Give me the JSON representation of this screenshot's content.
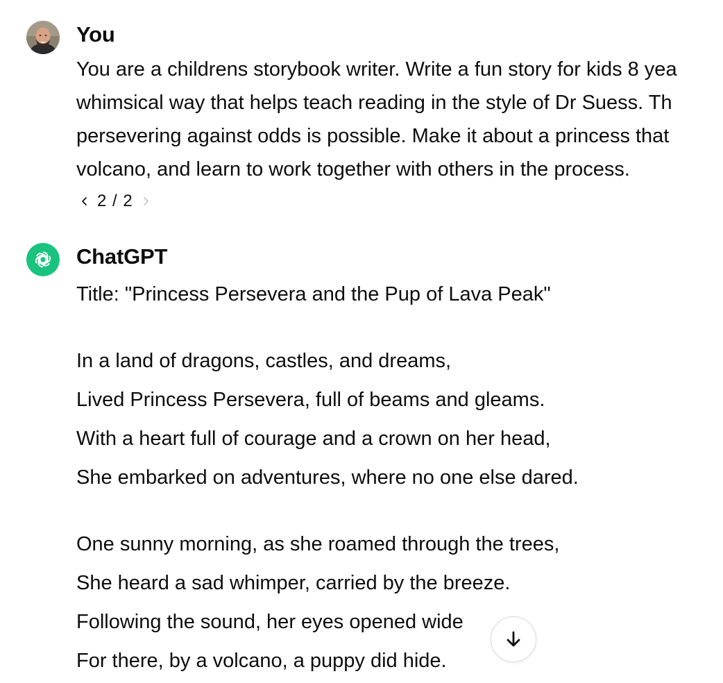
{
  "user": {
    "name": "You",
    "message_lines": [
      "You are a childrens storybook writer. Write a fun story for kids 8 yea",
      "whimsical way that helps teach reading in the style of Dr Suess. Th",
      "persevering against odds is possible. Make it about a princess that",
      "volcano, and learn to work together with others in the process."
    ],
    "pager": {
      "current": "2",
      "total": "2",
      "label": "2 / 2"
    }
  },
  "assistant": {
    "name": "ChatGPT",
    "title_line": "Title: \"Princess Persevera and the Pup of Lava Peak\"",
    "stanzas": [
      [
        "In a land of dragons, castles, and dreams,",
        "Lived Princess Persevera, full of beams and gleams.",
        "With a heart full of courage and a crown on her head,",
        "She embarked on adventures, where no one else dared."
      ],
      [
        "One sunny morning, as she roamed through the trees,",
        "She heard a sad whimper, carried by the breeze.",
        "Following the sound, her eyes opened wide",
        "For there, by a volcano, a puppy did hide."
      ]
    ]
  },
  "icons": {
    "user_avatar": "user-avatar-photo",
    "assistant_avatar": "openai-logo-icon",
    "pager_prev": "chevron-left-icon",
    "pager_next": "chevron-right-icon",
    "scroll_down": "arrow-down-icon"
  },
  "colors": {
    "assistant_avatar_bg": "#19c37d",
    "text": "#0d0d0d",
    "disabled_chevron": "#c5c5d2",
    "scroll_button_border": "#d9d9e3"
  }
}
